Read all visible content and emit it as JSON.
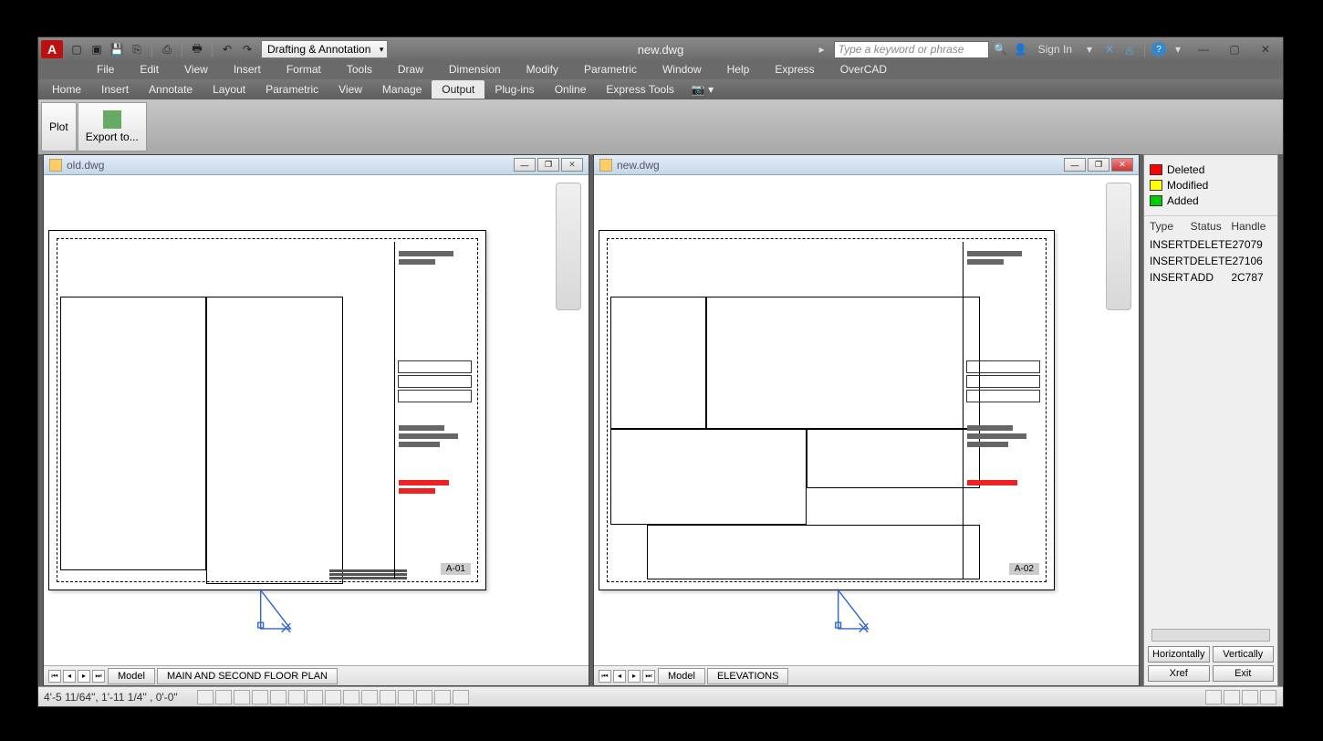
{
  "app_title": "new.dwg",
  "workspace": "Drafting & Annotation",
  "search_placeholder": "Type a keyword or phrase",
  "signin_label": "Sign In",
  "menubar": [
    "File",
    "Edit",
    "View",
    "Insert",
    "Format",
    "Tools",
    "Draw",
    "Dimension",
    "Modify",
    "Parametric",
    "Window",
    "Help",
    "Express",
    "OverCAD"
  ],
  "tabs": {
    "items": [
      "Home",
      "Insert",
      "Annotate",
      "Layout",
      "Parametric",
      "View",
      "Manage",
      "Output",
      "Plug-ins",
      "Online",
      "Express Tools"
    ],
    "active": "Output"
  },
  "ribbon": {
    "plot": "Plot",
    "export": "Export to..."
  },
  "docs": {
    "left": {
      "title": "old.dwg",
      "tabs": [
        "Model",
        "MAIN AND SECOND FLOOR PLAN"
      ],
      "sheet_num": "A-01"
    },
    "right": {
      "title": "new.dwg",
      "tabs": [
        "Model",
        "ELEVATIONS"
      ],
      "sheet_num": "A-02"
    }
  },
  "legend": {
    "deleted": "Deleted",
    "modified": "Modified",
    "added": "Added"
  },
  "table": {
    "headers": [
      "Type",
      "Status",
      "Handle"
    ],
    "rows": [
      [
        "INSERT",
        "DELETE",
        "27079"
      ],
      [
        "INSERT",
        "DELETE",
        "27106"
      ],
      [
        "INSERT",
        "ADD",
        "2C787"
      ]
    ]
  },
  "side_buttons": {
    "horiz": "Horizontally",
    "vert": "Vertically",
    "xref": "Xref",
    "exit": "Exit"
  },
  "status_coords": "4'-5 11/64\", 1'-11 1/4\"  , 0'-0\""
}
